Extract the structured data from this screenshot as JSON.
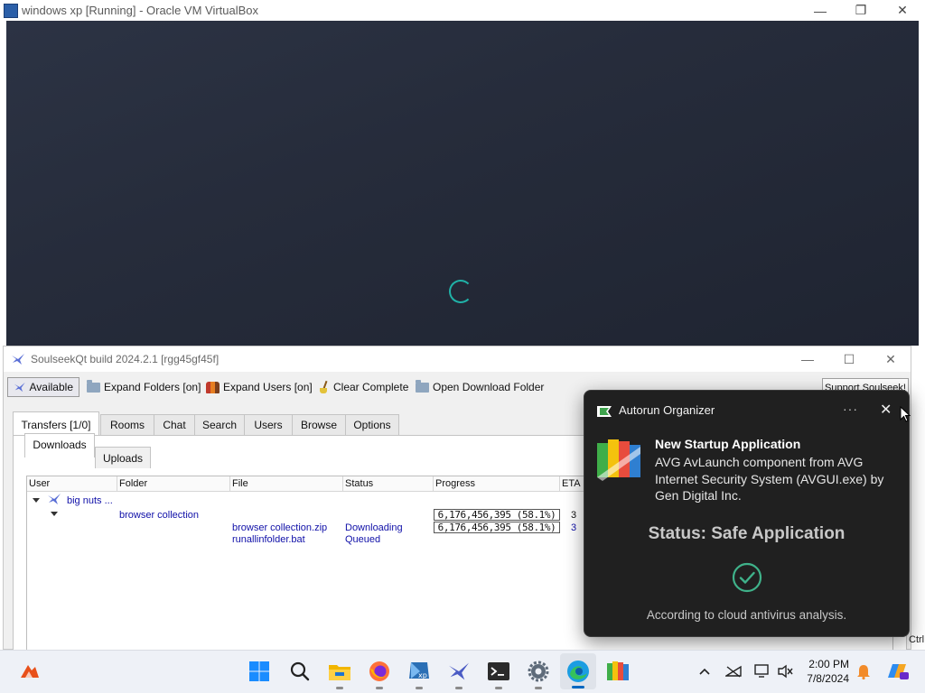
{
  "vbox": {
    "title": "windows xp [Running] - Oracle VM VirtualBox",
    "minimize": "—",
    "restore": "❐",
    "close": "✕"
  },
  "soulseek": {
    "title": "SoulseekQt build 2024.2.1 [rgg45gf45f]",
    "minimize": "—",
    "maximize": "☐",
    "close": "✕",
    "toolbar": {
      "available": "Available",
      "expand_folders": "Expand Folders [on]",
      "expand_users": "Expand Users [on]",
      "clear_complete": "Clear Complete",
      "open_download_folder": "Open Download Folder",
      "support": "Support Soulseek!"
    },
    "tabs": [
      "Transfers [1/0]",
      "Rooms",
      "Chat",
      "Search",
      "Users",
      "Browse",
      "Options"
    ],
    "subtabs": [
      "Downloads",
      "Uploads"
    ],
    "columns": [
      "User",
      "Folder",
      "File",
      "Status",
      "Progress",
      "ETA"
    ],
    "rows": {
      "user": "big nuts ...",
      "folder": "browser collection",
      "file1": "browser collection.zip",
      "status1": "Downloading",
      "progress_folder": "6,176,456,395 (58.1%)",
      "progress_file": "6,176,456,395 (58.1%)",
      "eta_folder": "3",
      "eta_file": "3",
      "file2": "runallinfolder.bat",
      "status2": "Queued"
    },
    "corner_label": "Ctrl"
  },
  "toast": {
    "app_name": "Autorun Organizer",
    "more": "···",
    "close": "✕",
    "heading": "New Startup Application",
    "body": "AVG AvLaunch component from AVG Internet Security System (AVGUI.exe) by Gen Digital Inc.",
    "status": "Status: Safe Application",
    "footer": "According to cloud antivirus analysis."
  },
  "taskbar": {
    "time": "2:00 PM",
    "date": "7/8/2024"
  },
  "colors": {
    "link_blue": "#1010a8",
    "toast_bg": "#202020",
    "check_green": "#3fb28a",
    "spinner": "#20b2a8"
  }
}
